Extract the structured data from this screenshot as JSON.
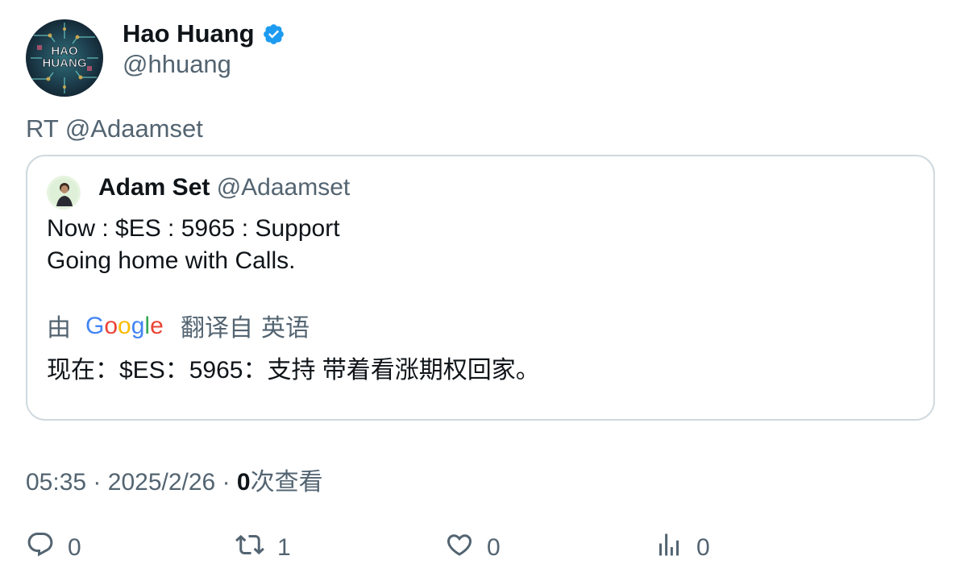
{
  "tweet": {
    "author": {
      "name": "Hao Huang",
      "handle": "@hhuang",
      "avatar_text_line1": "HAO",
      "avatar_text_line2": "HUANG",
      "verified": true
    },
    "rt_text": "RT @Adaamset",
    "quoted": {
      "name": "Adam Set",
      "handle": "@Adaamset",
      "lines": [
        "Now : $ES : 5965 : Support",
        "Going home with Calls."
      ],
      "translation": {
        "by_label": "由",
        "provider": "Google",
        "translated_from_label": "翻译自",
        "source_language": "英语",
        "text": "现在：$ES：5965：支持 带着看涨期权回家。"
      }
    },
    "meta": {
      "time": "05:35",
      "separator": "·",
      "date": "2025/2/26",
      "views_count": "0",
      "views_label": "次查看"
    },
    "actions": {
      "reply_count": "0",
      "retweet_count": "1",
      "like_count": "0",
      "views_count": "0"
    }
  },
  "colors": {
    "text_primary": "#0f1419",
    "text_secondary": "#536471",
    "border": "#cfd9de",
    "verified_blue": "#1d9bf0"
  },
  "icons": [
    "verified-badge-icon",
    "reply-icon",
    "retweet-icon",
    "like-icon",
    "views-icon",
    "google-logo"
  ]
}
